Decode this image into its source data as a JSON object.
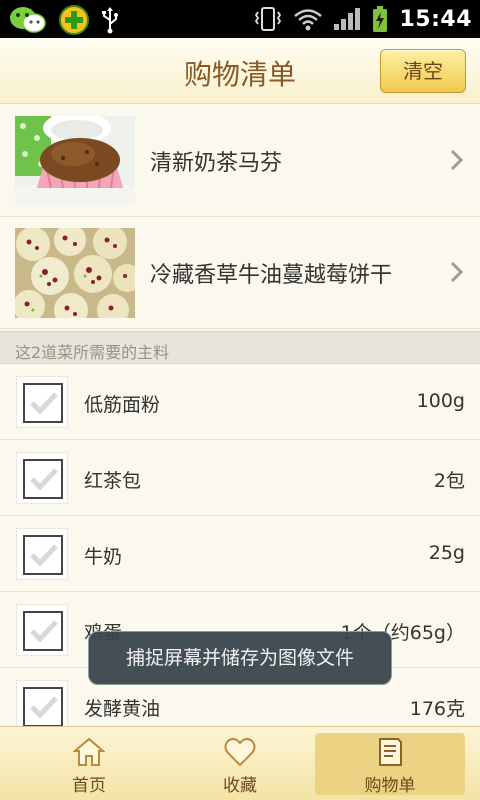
{
  "status_bar": {
    "time": "15:44",
    "left_icons": [
      "wechat-icon",
      "plus-app-icon",
      "usb-icon"
    ],
    "right_icons": [
      "vibrate-icon",
      "wifi-icon",
      "signal-icon",
      "battery-charging-icon"
    ]
  },
  "header": {
    "title": "购物清单",
    "clear_label": "清空"
  },
  "recipes": [
    {
      "name": "清新奶茶马芬"
    },
    {
      "name": "冷藏香草牛油蔓越莓饼干"
    }
  ],
  "section": {
    "title": "这2道菜所需要的主料"
  },
  "ingredients": [
    {
      "name": "低筋面粉",
      "amount": "100g"
    },
    {
      "name": "红茶包",
      "amount": "2包"
    },
    {
      "name": "牛奶",
      "amount": "25g"
    },
    {
      "name": "鸡蛋",
      "amount": "1个（约65g）"
    },
    {
      "name": "发酵黄油",
      "amount": "176克"
    }
  ],
  "toast": {
    "message": "捕捉屏幕并储存为图像文件"
  },
  "bottom_nav": {
    "items": [
      {
        "label": "首页",
        "icon": "home-icon"
      },
      {
        "label": "收藏",
        "icon": "heart-icon"
      },
      {
        "label": "购物单",
        "icon": "shopping-list-icon"
      }
    ],
    "active_index": 2
  },
  "colors": {
    "accent": "#efc94d",
    "title_brown": "#8a5a25",
    "background": "#fbf8ee"
  }
}
